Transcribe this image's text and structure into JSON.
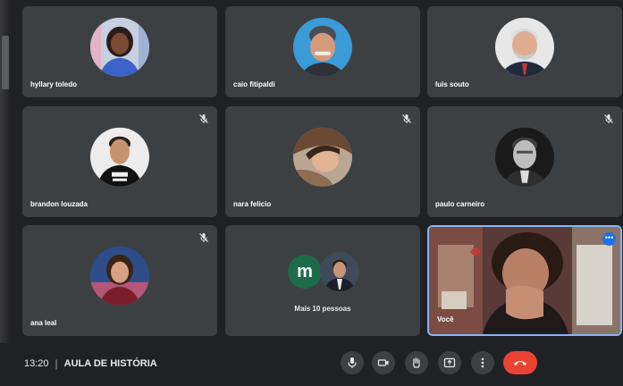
{
  "colors": {
    "background": "#202124",
    "tile": "#3c4043",
    "self_border": "#8ab4f8",
    "end_call": "#ea4335",
    "more_avatar": "#1e6b4c"
  },
  "participants": [
    {
      "name": "hyllary toledo",
      "muted": false
    },
    {
      "name": "caio fitipaldi",
      "muted": false
    },
    {
      "name": "luis souto",
      "muted": false
    },
    {
      "name": "brandon louzada",
      "muted": true
    },
    {
      "name": "nara felicio",
      "muted": true
    },
    {
      "name": "paulo carneiro",
      "muted": true
    },
    {
      "name": "ana leal",
      "muted": true
    }
  ],
  "more": {
    "initial": "m",
    "label": "Mais 10 pessoas"
  },
  "self": {
    "name": "Você",
    "options_icon": "more-dots-icon"
  },
  "meeting": {
    "time": "13:20",
    "separator": "|",
    "title": "AULA DE HISTÓRIA"
  },
  "controls": [
    "microphone-icon",
    "camera-icon",
    "raise-hand-icon",
    "present-screen-icon",
    "more-options-icon",
    "end-call-icon"
  ]
}
